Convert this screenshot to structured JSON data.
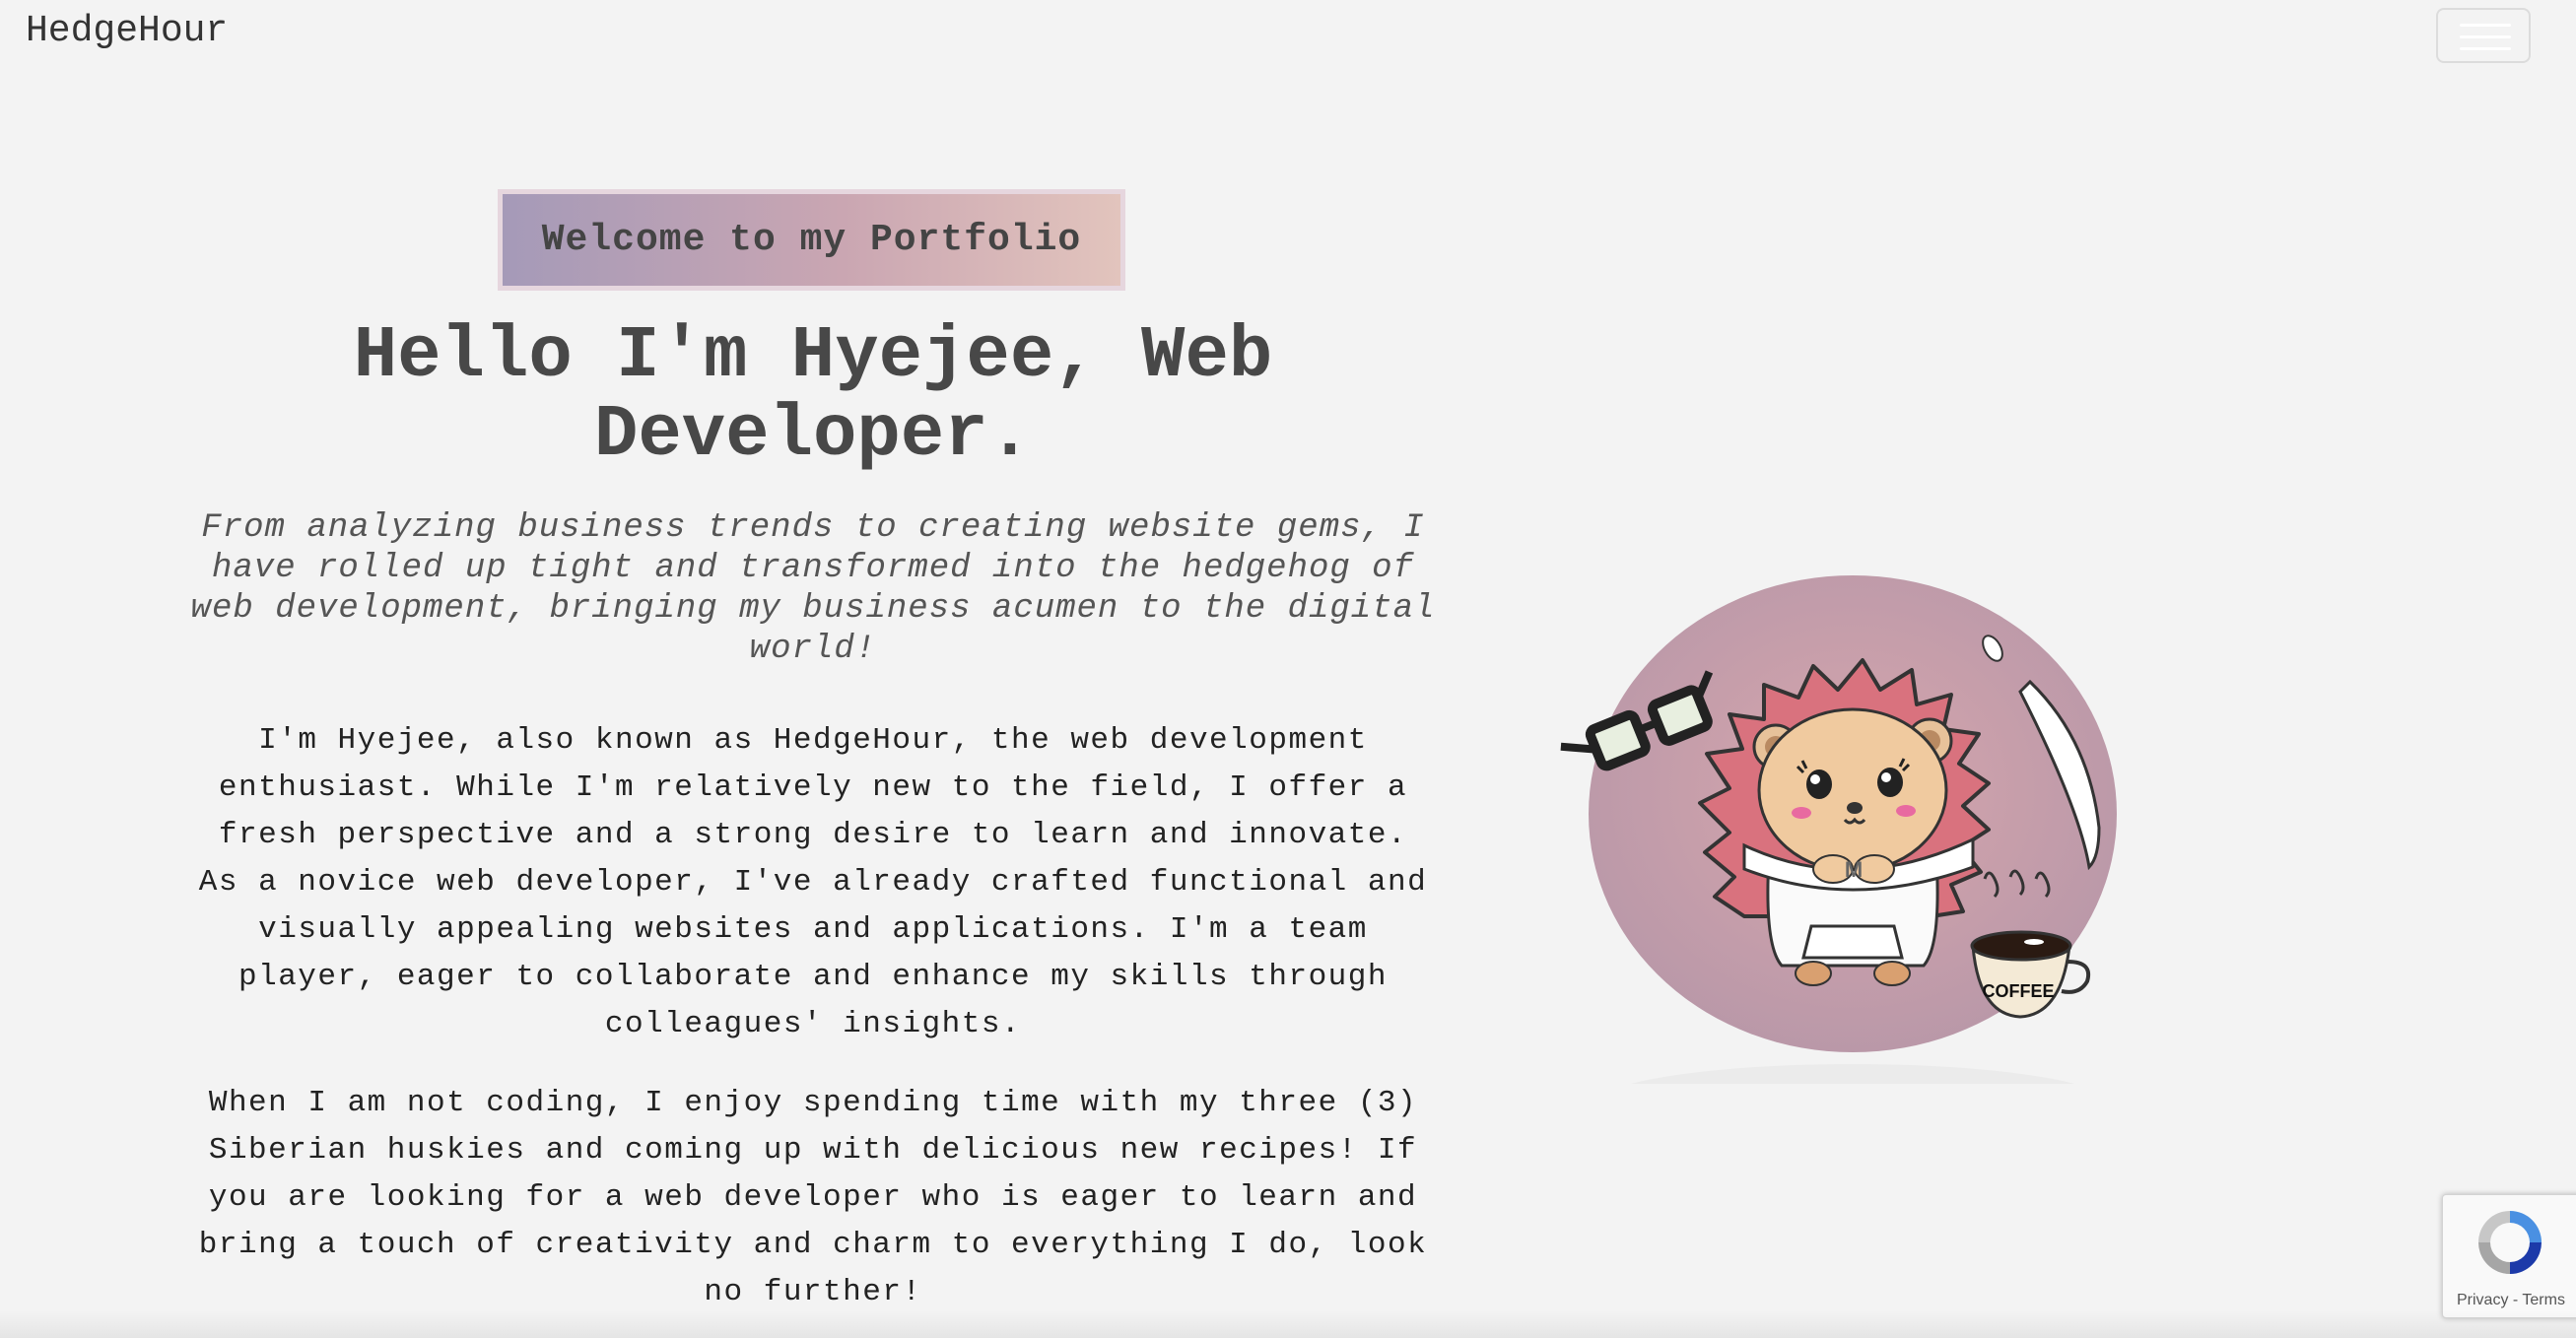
{
  "navbar": {
    "brand": "HedgeHour",
    "menu_toggle_icon": "hamburger-menu-icon"
  },
  "hero": {
    "badge": "Welcome to my Portfolio",
    "headline_line1": "Hello I'm Hyejee, Web",
    "headline_line2": "Developer.",
    "tagline": "From analyzing business trends to creating website gems, I have rolled up tight and transformed into the hedgehog of web development, bringing my business acumen to the digital world!",
    "paragraph1": "I'm Hyejee, also known as HedgeHour, the web development enthusiast. While I'm relatively new to the field, I offer a fresh perspective and a strong desire to learn and innovate. As a novice web developer, I've already crafted functional and visually appealing websites and applications. I'm a team player, eager to collaborate and enhance my skills through colleagues' insights.",
    "paragraph2": "When I am not coding, I enjoy spending time with my three (3) Siberian huskies and coming up with delicious new recipes! If you are looking for a web developer who is eager to learn and bring a touch of creativity and charm to everything I do, look no further!"
  },
  "avatar": {
    "icon": "hedgehog-avatar-icon",
    "cup_label": "COFFEE",
    "circle_color": "#b998a8",
    "spike_color": "#d9727e"
  },
  "recaptcha": {
    "icon": "recaptcha-icon",
    "links": "Privacy - Terms"
  }
}
